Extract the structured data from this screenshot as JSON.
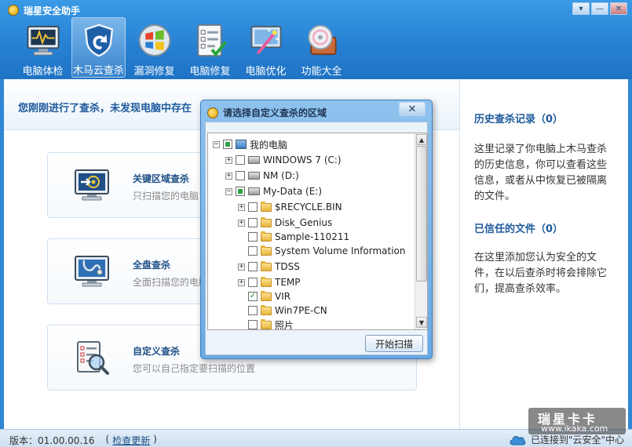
{
  "app": {
    "title": "瑞星安全助手"
  },
  "window_controls": {
    "menu": "▾",
    "minimize": "—",
    "close": "✕"
  },
  "toolbar": {
    "items": [
      {
        "label": "电脑体检",
        "icon": "monitor-pulse-icon",
        "active": false
      },
      {
        "label": "木马云查杀",
        "icon": "shield-icon",
        "active": true
      },
      {
        "label": "漏洞修复",
        "icon": "windows-logo-icon",
        "active": false
      },
      {
        "label": "电脑修复",
        "icon": "checklist-icon",
        "active": false
      },
      {
        "label": "电脑优化",
        "icon": "magic-wand-icon",
        "active": false
      },
      {
        "label": "功能大全",
        "icon": "disc-toolbox-icon",
        "active": false
      }
    ]
  },
  "notice": {
    "text": "您刚刚进行了查杀，未发现电脑中存在"
  },
  "cards": [
    {
      "title": "关键区域查杀",
      "desc": "只扫描您的电脑",
      "icon": "target-monitor-icon"
    },
    {
      "title": "全盘查杀",
      "desc": "全面扫描您的电脑",
      "icon": "stethoscope-monitor-icon"
    },
    {
      "title": "自定义查杀",
      "desc": "您可以自己指定要扫描的位置",
      "icon": "magnifier-checklist-icon"
    }
  ],
  "right_panel": {
    "history_title": "历史查杀记录（0）",
    "history_text": "这里记录了你电脑上木马查杀的历史信息，你可以查看这些信息，或者从中恢复已被隔离的文件。",
    "trusted_title": "已信任的文件（0）",
    "trusted_text": "在这里添加您认为安全的文件，在以后查杀时将会排除它们，提高查杀效率。"
  },
  "dialog": {
    "title": "请选择自定义查杀的区域",
    "close_label": "✕",
    "scan_button": "开始扫描",
    "tree": [
      {
        "label": "我的电脑",
        "level": 0,
        "expander": "⊟",
        "check": "partial",
        "icon": "computer-icon"
      },
      {
        "label": "WINDOWS 7 (C:)",
        "level": 1,
        "expander": "⊞",
        "check": "none",
        "icon": "drive-icon"
      },
      {
        "label": "NM (D:)",
        "level": 1,
        "expander": "⊞",
        "check": "none",
        "icon": "drive-icon"
      },
      {
        "label": "My-Data (E:)",
        "level": 1,
        "expander": "⊟",
        "check": "partial",
        "icon": "drive-icon"
      },
      {
        "label": "$RECYCLE.BIN",
        "level": 2,
        "expander": "⊞",
        "check": "none",
        "icon": "folder-icon"
      },
      {
        "label": "Disk_Genius",
        "level": 2,
        "expander": "⊞",
        "check": "none",
        "icon": "folder-icon"
      },
      {
        "label": "Sample-110211",
        "level": 2,
        "expander": "",
        "check": "none",
        "icon": "folder-icon"
      },
      {
        "label": "System Volume Information",
        "level": 2,
        "expander": "",
        "check": "none",
        "icon": "folder-icon"
      },
      {
        "label": "TDSS",
        "level": 2,
        "expander": "⊞",
        "check": "none",
        "icon": "folder-icon"
      },
      {
        "label": "TEMP",
        "level": 2,
        "expander": "⊞",
        "check": "none",
        "icon": "folder-icon"
      },
      {
        "label": "VIR",
        "level": 2,
        "expander": "",
        "check": "checked",
        "icon": "folder-icon"
      },
      {
        "label": "Win7PE-CN",
        "level": 2,
        "expander": "",
        "check": "none",
        "icon": "folder-icon"
      },
      {
        "label": "照片",
        "level": 2,
        "expander": "",
        "check": "none",
        "icon": "folder-icon"
      }
    ]
  },
  "statusbar": {
    "version": "版本：01.00.00.16",
    "paren_open": "(",
    "update_link": "检查更新",
    "paren_close": ")",
    "connection": "已连接到\"云安全\"中心"
  },
  "watermark": {
    "brand": "瑞星卡卡",
    "url": "www.ikaka.com"
  },
  "colors": {
    "accent": "#2680d2",
    "heading": "#1e5a9c",
    "check_green": "#2da042"
  }
}
